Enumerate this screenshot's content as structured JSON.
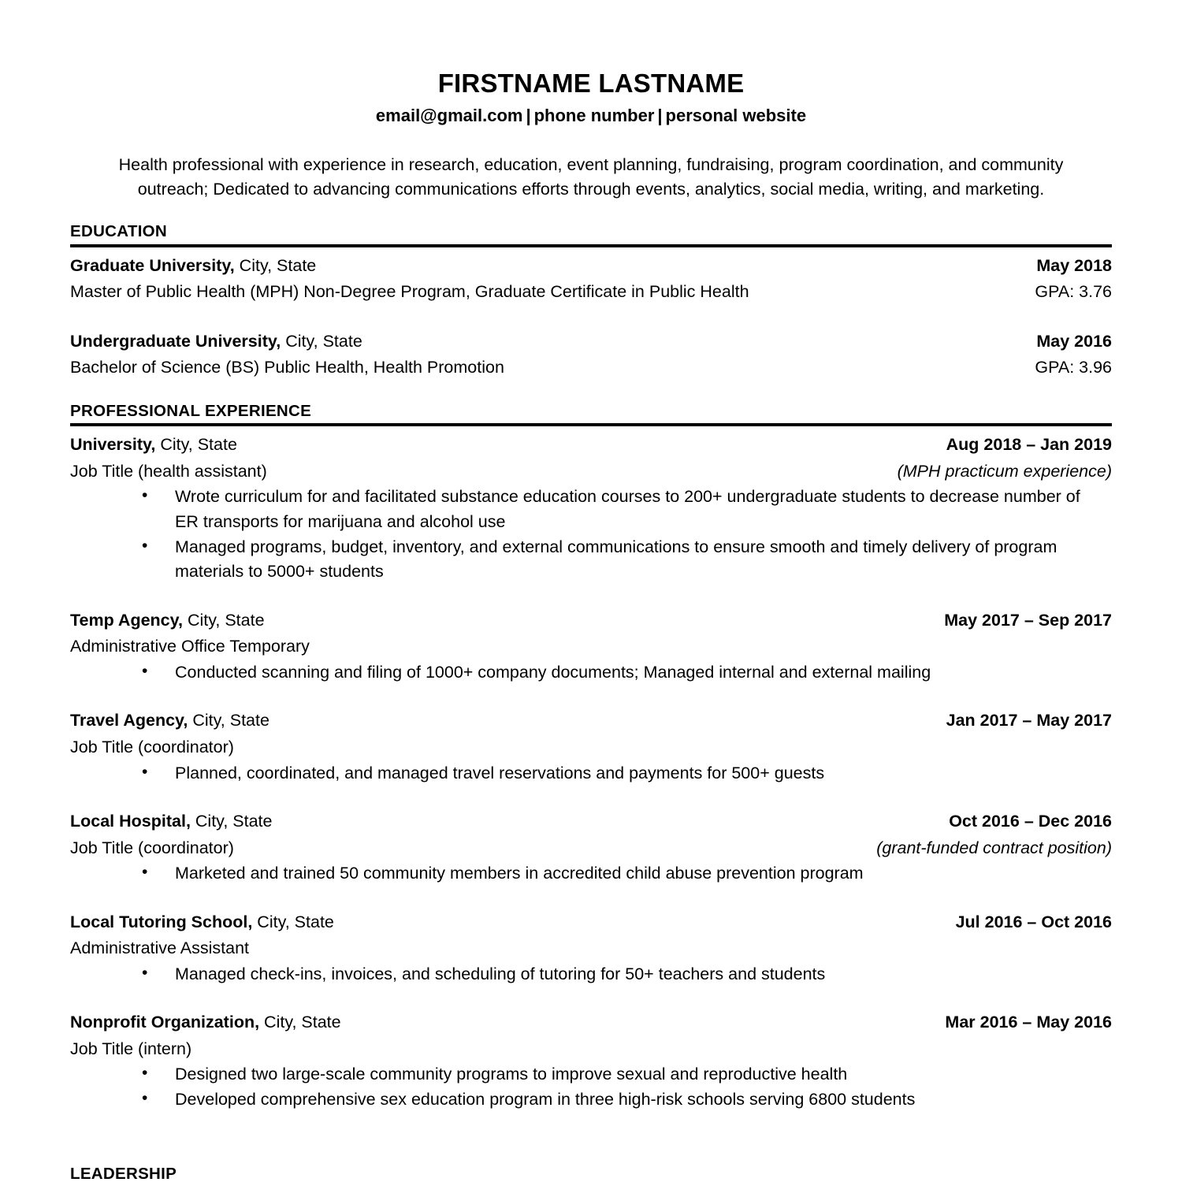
{
  "header": {
    "name": "FIRSTNAME LASTNAME",
    "email": "email@gmail.com",
    "separator1": "|",
    "phone": "phone number",
    "separator2": "|",
    "website": "personal website",
    "summary": "Health professional with experience in research, education, event planning, fundraising, program coordination, and community outreach; Dedicated to advancing communications efforts through events, analytics, social media, writing, and marketing."
  },
  "education": {
    "title": "EDUCATION",
    "entries": [
      {
        "org": "Graduate University,",
        "location": " City, State",
        "date": "May 2018",
        "degree": "Master of Public Health (MPH) Non-Degree Program, Graduate Certificate in Public Health",
        "gpa": "GPA: 3.76"
      },
      {
        "org": "Undergraduate University,",
        "location": " City, State",
        "date": "May 2016",
        "degree": "Bachelor of Science (BS) Public Health, Health Promotion",
        "gpa": "GPA: 3.96"
      }
    ]
  },
  "experience": {
    "title": "PROFESSIONAL EXPERIENCE",
    "entries": [
      {
        "org": "University,",
        "location": " City, State",
        "date": "Aug 2018 – Jan 2019",
        "job_title": "Job Title (health assistant)",
        "note": "(MPH practicum experience)",
        "note_italic": true,
        "bullets": [
          "Wrote curriculum for and facilitated substance education courses to 200+ undergraduate students to decrease number of ER transports for marijuana and alcohol use",
          "Managed programs, budget, inventory, and external communications to ensure smooth and timely delivery of program materials to 5000+ students"
        ]
      },
      {
        "org": "Temp Agency,",
        "location": " City, State",
        "date": "May 2017 – Sep 2017",
        "job_title": "Administrative Office Temporary",
        "note": "",
        "note_italic": false,
        "bullets": [
          "Conducted scanning and filing of 1000+ company documents; Managed internal and external mailing"
        ]
      },
      {
        "org": "Travel Agency,",
        "location": " City, State",
        "date": "Jan 2017 – May 2017",
        "job_title": "Job Title (coordinator)",
        "note": "",
        "note_italic": false,
        "bullets": [
          "Planned, coordinated, and managed travel reservations and payments for 500+ guests"
        ]
      },
      {
        "org": "Local Hospital,",
        "location": " City, State",
        "date": "Oct 2016 – Dec 2016",
        "job_title": "Job Title (coordinator)",
        "note": "(grant-funded contract position)",
        "note_italic": true,
        "bullets": [
          "Marketed and trained 50 community members in accredited child abuse prevention program"
        ]
      },
      {
        "org": "Local Tutoring School,",
        "location": " City, State",
        "date": "Jul 2016 – Oct 2016",
        "job_title": "Administrative Assistant",
        "note": "",
        "note_italic": false,
        "bullets": [
          "Managed check-ins, invoices, and scheduling of tutoring for 50+ teachers and students"
        ]
      },
      {
        "org": "Nonprofit Organization,",
        "location": " City, State",
        "date": "Mar 2016 – May 2016",
        "job_title": "Job Title (intern)",
        "note": "",
        "note_italic": false,
        "bullets": [
          "Designed two large-scale community programs to improve sexual and reproductive health",
          "Developed comprehensive sex education program in three high-risk schools serving 6800 students"
        ]
      }
    ]
  },
  "leadership": {
    "title": "LEADERSHIP"
  }
}
